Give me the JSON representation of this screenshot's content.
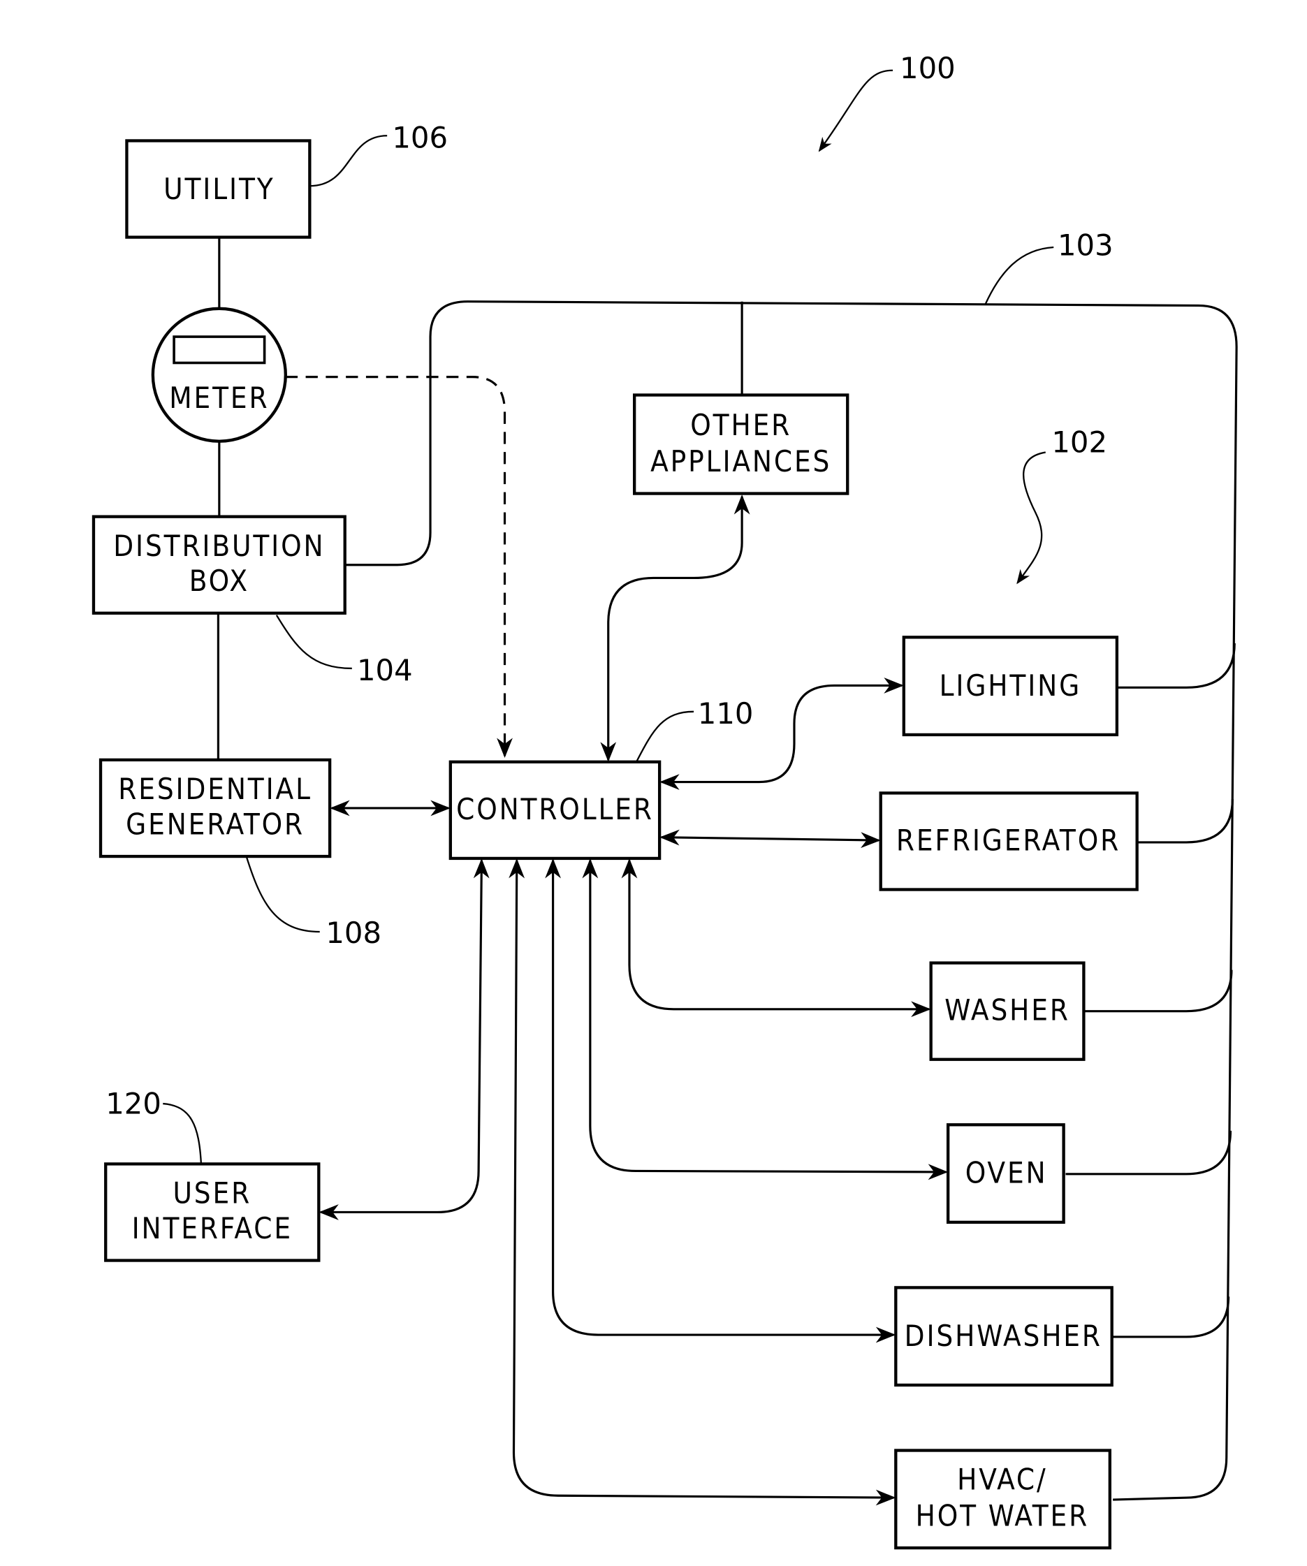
{
  "figure": {
    "id_label": "100",
    "blocks": {
      "utility": {
        "lines": [
          "UTILITY"
        ],
        "ref": "106"
      },
      "meter": {
        "lines": [
          "METER"
        ]
      },
      "distribution_box": {
        "lines": [
          "DISTRIBUTION",
          "BOX"
        ],
        "ref": "104"
      },
      "residential_generator": {
        "lines": [
          "RESIDENTIAL",
          "GENERATOR"
        ],
        "ref": "108"
      },
      "controller": {
        "lines": [
          "CONTROLLER"
        ],
        "ref": "110"
      },
      "user_interface": {
        "lines": [
          "USER",
          "INTERFACE"
        ],
        "ref": "120"
      },
      "other_appliances": {
        "lines": [
          "OTHER",
          "APPLIANCES"
        ]
      },
      "lighting": {
        "lines": [
          "LIGHTING"
        ]
      },
      "refrigerator": {
        "lines": [
          "REFRIGERATOR"
        ]
      },
      "washer": {
        "lines": [
          "WASHER"
        ]
      },
      "oven": {
        "lines": [
          "OVEN"
        ]
      },
      "dishwasher": {
        "lines": [
          "DISHWASHER"
        ]
      },
      "hvac": {
        "lines": [
          "HVAC/",
          "HOT WATER"
        ]
      }
    },
    "refs": {
      "power_line": "103",
      "appliances_group": "102"
    }
  }
}
